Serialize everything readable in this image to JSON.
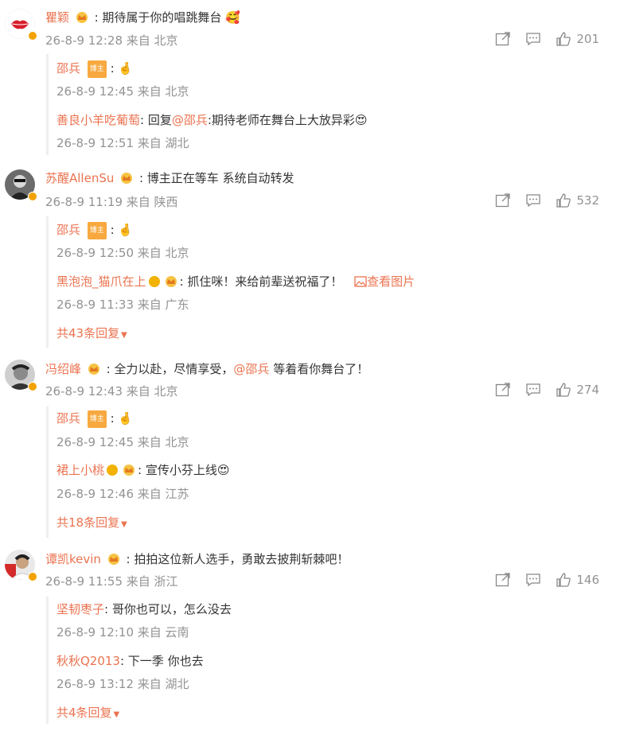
{
  "comments": [
    {
      "user": "瞿颖",
      "text": ": 期待属于你的唱跳舞台",
      "emoji": "🥰",
      "time": "26-8-9 12:28 来自 北京",
      "likes": "201",
      "replies": [
        {
          "user": "邵兵",
          "tag": "博主",
          "text": ": ",
          "emoji": "🤞",
          "time": "26-8-9 12:45 来自 北京"
        },
        {
          "user": "善良小羊吃葡萄",
          "pre": ": 回复",
          "at": "@邵兵",
          "text": ":期待老师在舞台上大放异彩",
          "emoji": "😍",
          "time": "26-8-9 12:51 来自 湖北"
        }
      ]
    },
    {
      "user": "苏醒AllenSu",
      "text": ": 博主正在等车 系统自动转发",
      "time": "26-8-9 11:19 来自 陕西",
      "likes": "532",
      "replies": [
        {
          "user": "邵兵",
          "tag": "博主",
          "text": ": ",
          "emoji": "🤞",
          "time": "26-8-9 12:50 来自 北京"
        },
        {
          "user": "黑泡泡_猫爪在上",
          "text": ": 抓住咪！来给前辈送祝福了！",
          "img": "查看图片",
          "time": "26-8-9 11:33 来自 广东"
        }
      ],
      "more": "共43条回复"
    },
    {
      "user": "冯绍峰",
      "text": ": 全力以赴，尽情享受，",
      "at": "@邵兵",
      "text2": " 等着看你舞台了！",
      "time": "26-8-9 12:43 来自 北京",
      "likes": "274",
      "replies": [
        {
          "user": "邵兵",
          "tag": "博主",
          "text": ": ",
          "emoji": "🤞",
          "time": "26-8-9 12:45 来自 北京"
        },
        {
          "user": "裙上小桃",
          "text": ": 宣传小芬上线",
          "emoji": "😍",
          "time": "26-8-9 12:46 来自 江苏"
        }
      ],
      "more": "共18条回复"
    },
    {
      "user": "谭凯kevin",
      "text": ": 拍拍这位新人选手，勇敢去披荆斩棘吧！",
      "time": "26-8-9 11:55 来自 浙江",
      "likes": "146",
      "replies": [
        {
          "user": "坚韧枣子",
          "text": ": 哥你也可以，怎么没去",
          "time": "26-8-9 12:10 来自 云南"
        },
        {
          "user": "秋秋Q2013",
          "text": ": 下一季 你也去",
          "time": "26-8-9 13:12 来自 湖北"
        }
      ],
      "more": "共4条回复"
    }
  ],
  "colors": {
    "accent": "#eb7350",
    "meta": "#939393",
    "vip": "#f2a200"
  },
  "icons": [
    "share-icon",
    "comment-icon",
    "like-icon",
    "crown-icon",
    "verified-badge",
    "image-icon",
    "caret-down-icon"
  ]
}
